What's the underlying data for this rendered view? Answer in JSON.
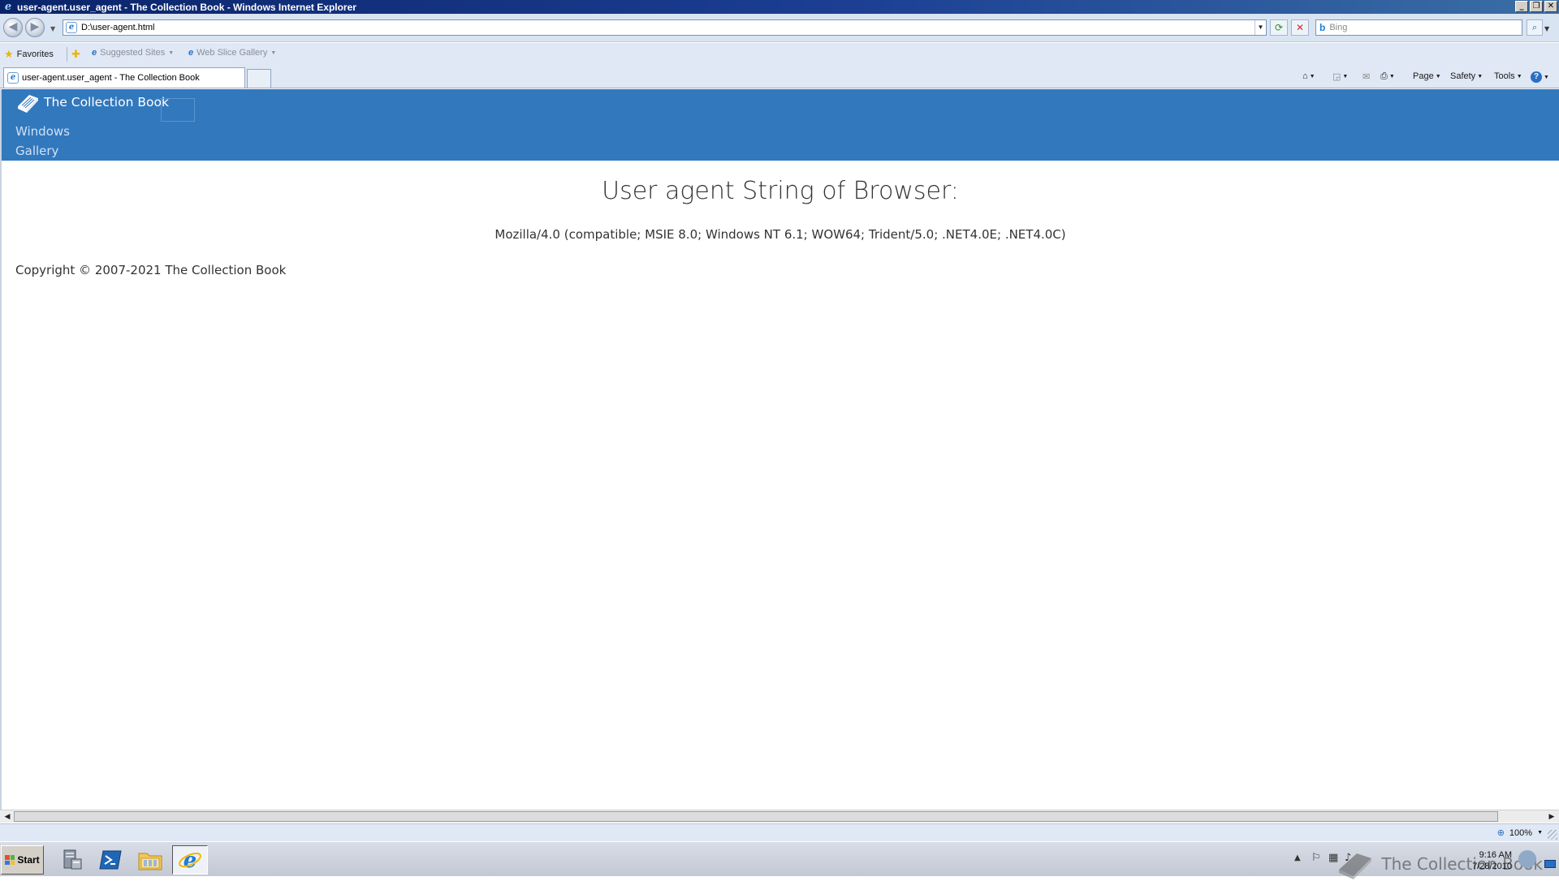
{
  "window": {
    "title": "user-agent.user_agent - The Collection Book - Windows Internet Explorer",
    "controls": [
      "_",
      "❐",
      "✕"
    ]
  },
  "addressbar": {
    "url": "D:\\user-agent.html",
    "search_placeholder": "Bing"
  },
  "favoritesbar": {
    "favorites_label": "Favorites",
    "suggested_sites_label": "Suggested Sites",
    "web_slice_gallery_label": "Web Slice Gallery"
  },
  "tabs": {
    "active_tab_title": "user-agent.user_agent - The Collection Book"
  },
  "commandbar": {
    "page_label": "Page",
    "safety_label": "Safety",
    "tools_label": "Tools"
  },
  "site": {
    "brand": "The Collection Book",
    "nav": [
      "Windows",
      "Gallery"
    ],
    "heading": "User agent String of Browser:",
    "user_agent": "Mozilla/4.0 (compatible; MSIE 8.0; Windows NT 6.1; WOW64; Trident/5.0; .NET4.0E; .NET4.0C)",
    "copyright": "Copyright © 2007-2021 The Collection Book",
    "colors": {
      "header_bg": "#3278bd",
      "brand_text": "#ffffff",
      "nav_text": "#cfe1f3",
      "body_text": "#333333"
    }
  },
  "statusbar": {
    "zoom": "100%"
  },
  "taskbar": {
    "start_label": "Start",
    "pinned_icons": [
      "server-manager-icon",
      "powershell-icon",
      "explorer-icon",
      "internet-explorer-icon"
    ],
    "clock_time": "9:16 AM",
    "clock_date": "7/28/2010",
    "watermark": "The Collection Book"
  }
}
